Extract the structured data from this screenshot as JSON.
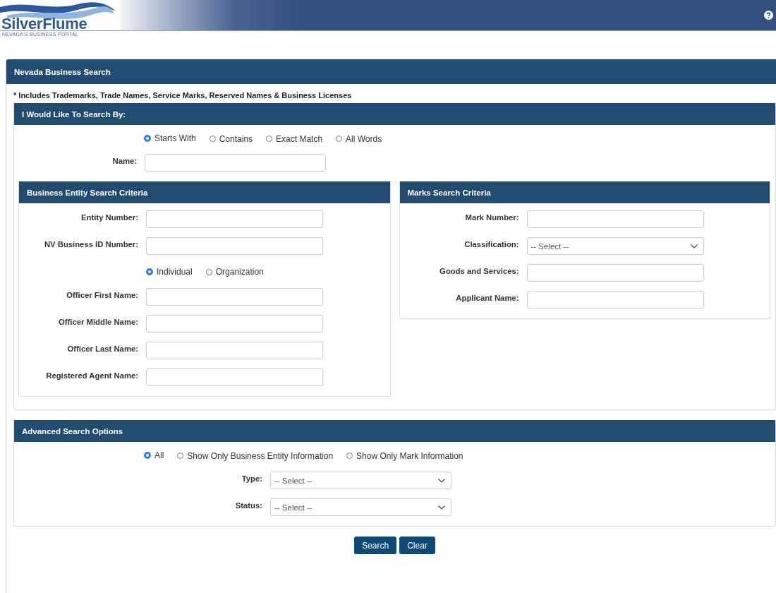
{
  "header": {
    "logo_title": "SilverFlume",
    "logo_subtitle": "NEVADA'S BUSINESS PORTAL"
  },
  "page_panel": {
    "title": "Nevada Business Search",
    "note": "* Includes Trademarks, Trade Names, Service Marks, Reserved Names & Business Licenses"
  },
  "search_by": {
    "title": "I Would Like To Search By:",
    "match_options": [
      {
        "label": "Starts With",
        "selected": true
      },
      {
        "label": "Contains",
        "selected": false
      },
      {
        "label": "Exact Match",
        "selected": false
      },
      {
        "label": "All Words",
        "selected": false
      }
    ],
    "rows": [
      {
        "kind": "text",
        "label": "Name:"
      }
    ]
  },
  "entity_criteria": {
    "title": "Business Entity Search Criteria",
    "rows": [
      {
        "kind": "text",
        "label": "Entity Number:"
      },
      {
        "kind": "text",
        "label": "NV Business ID Number:"
      },
      {
        "kind": "radios",
        "options": [
          {
            "label": "Individual",
            "selected": true
          },
          {
            "label": "Organization",
            "selected": false
          }
        ]
      },
      {
        "kind": "text",
        "label": "Officer First Name:"
      },
      {
        "kind": "text",
        "label": "Officer Middle Name:"
      },
      {
        "kind": "text",
        "label": "Officer Last Name:"
      },
      {
        "kind": "text",
        "label": "Registered Agent Name:"
      }
    ]
  },
  "marks_criteria": {
    "title": "Marks Search Criteria",
    "rows": [
      {
        "kind": "text",
        "label": "Mark Number:"
      },
      {
        "kind": "select",
        "label": "Classification:",
        "value": "-- Select --"
      },
      {
        "kind": "text",
        "label": "Goods and Services:"
      },
      {
        "kind": "text",
        "label": "Applicant Name:"
      }
    ]
  },
  "advanced": {
    "title": "Advanced Search Options",
    "display_options": [
      {
        "label": "All",
        "selected": true
      },
      {
        "label": "Show Only Business Entity Information",
        "selected": false
      },
      {
        "label": "Show Only Mark Information",
        "selected": false
      }
    ],
    "rows": [
      {
        "kind": "select",
        "label": "Type:",
        "value": "-- Select --"
      },
      {
        "kind": "select",
        "label": "Status:",
        "value": "-- Select --"
      }
    ]
  },
  "buttons": [
    {
      "label": "Search"
    },
    {
      "label": "Clear"
    }
  ]
}
